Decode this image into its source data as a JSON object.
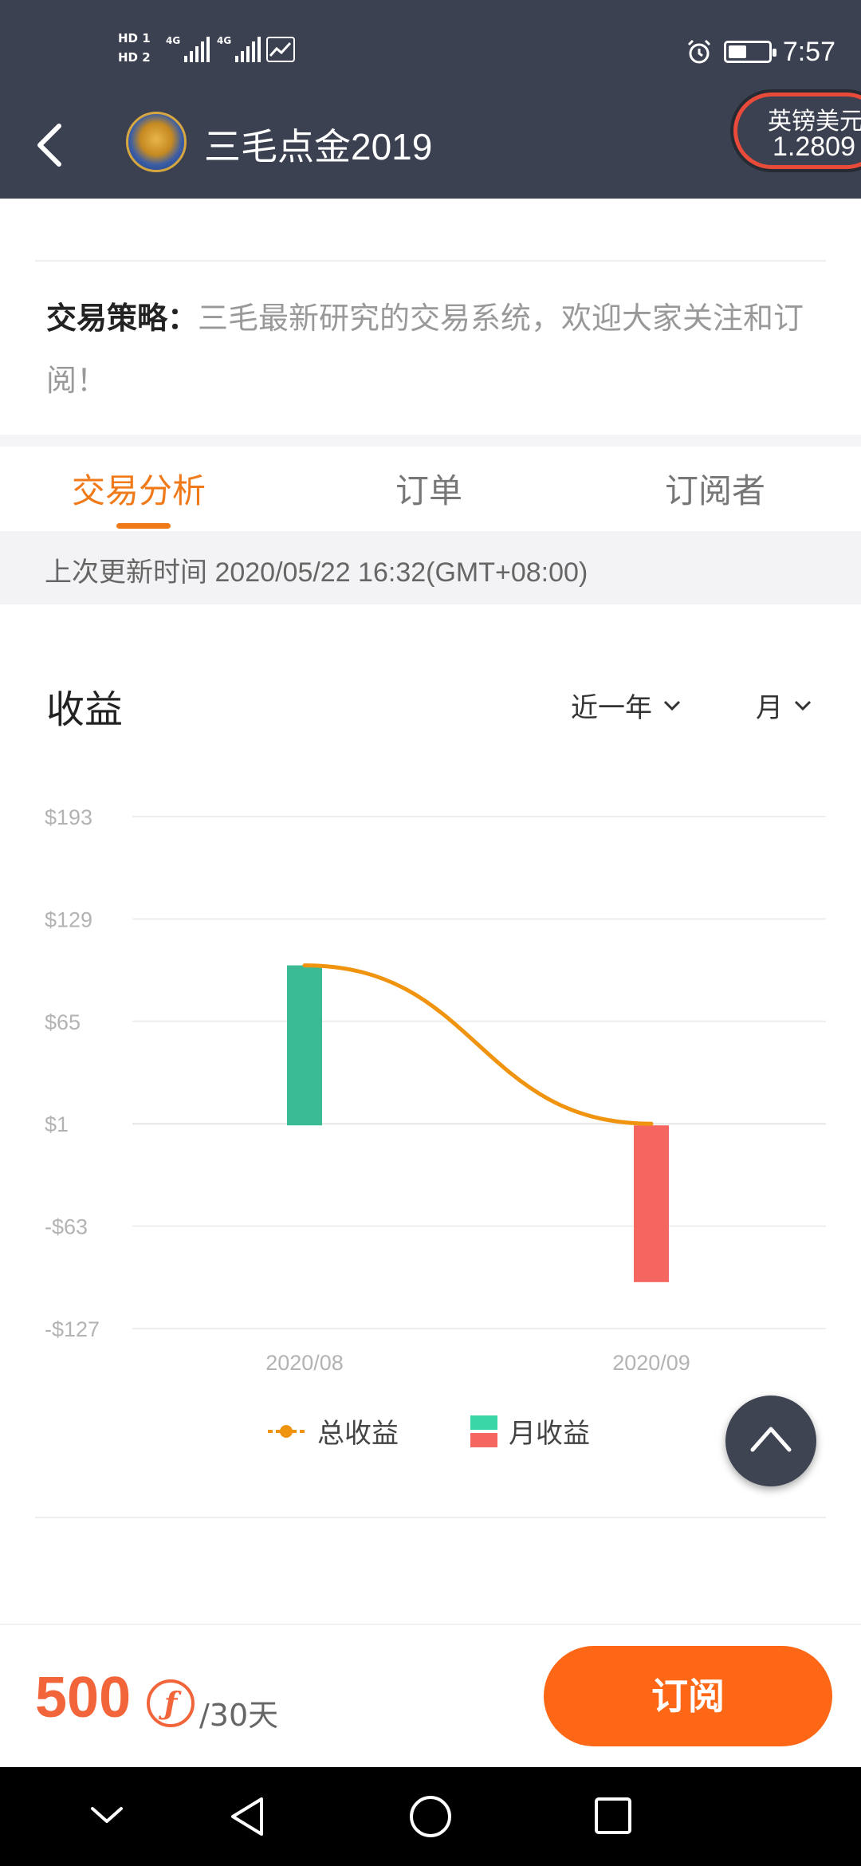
{
  "status_bar": {
    "sim1": "HD 1",
    "sim2": "HD 2",
    "net1": "4G",
    "net2": "4G",
    "time": "7:57"
  },
  "header": {
    "title": "三毛点金2019",
    "quote_pair": "英镑美元",
    "quote_price": "1.2809"
  },
  "strategy": {
    "label": "交易策略：",
    "text": "三毛最新研究的交易系统，欢迎大家关注和订阅！"
  },
  "tabs": [
    {
      "label": "交易分析",
      "active": true
    },
    {
      "label": "订单",
      "active": false
    },
    {
      "label": "订阅者",
      "active": false
    }
  ],
  "last_update": "上次更新时间 2020/05/22 16:32(GMT+08:00)",
  "chart_section": {
    "title": "收益",
    "range_filter": "近一年",
    "period_filter": "月"
  },
  "chart_data": {
    "type": "bar",
    "categories": [
      "2020/08",
      "2020/09"
    ],
    "series": [
      {
        "name": "月收益",
        "type": "bar",
        "values": [
          100,
          -98
        ],
        "colors": [
          "#3bbb94",
          "#f4665f"
        ]
      },
      {
        "name": "总收益",
        "type": "line",
        "values": [
          100,
          1
        ],
        "color": "#f0930f"
      }
    ],
    "y_ticks": [
      "$193",
      "$129",
      "$65",
      "$1",
      "-$63",
      "-$127"
    ],
    "y_tick_values": [
      193,
      129,
      65,
      1,
      -63,
      -127
    ],
    "ylim": [
      -127,
      193
    ],
    "grid": true,
    "legend": [
      {
        "label": "总收益",
        "marker": "line-dot",
        "color": "#f0930f"
      },
      {
        "label": "月收益",
        "marker": "two-squares",
        "colors": [
          "#3bd6a6",
          "#f4665f"
        ]
      }
    ],
    "legend_position": "bottom"
  },
  "subscribe": {
    "price": "500",
    "currency_symbol": "ƒ",
    "period": "/30天",
    "button_label": "订阅"
  },
  "colors": {
    "header_bg": "#3b4150",
    "accent_orange": "#f07a1a",
    "button_orange": "#fd6716",
    "price_orange": "#f2643a"
  }
}
